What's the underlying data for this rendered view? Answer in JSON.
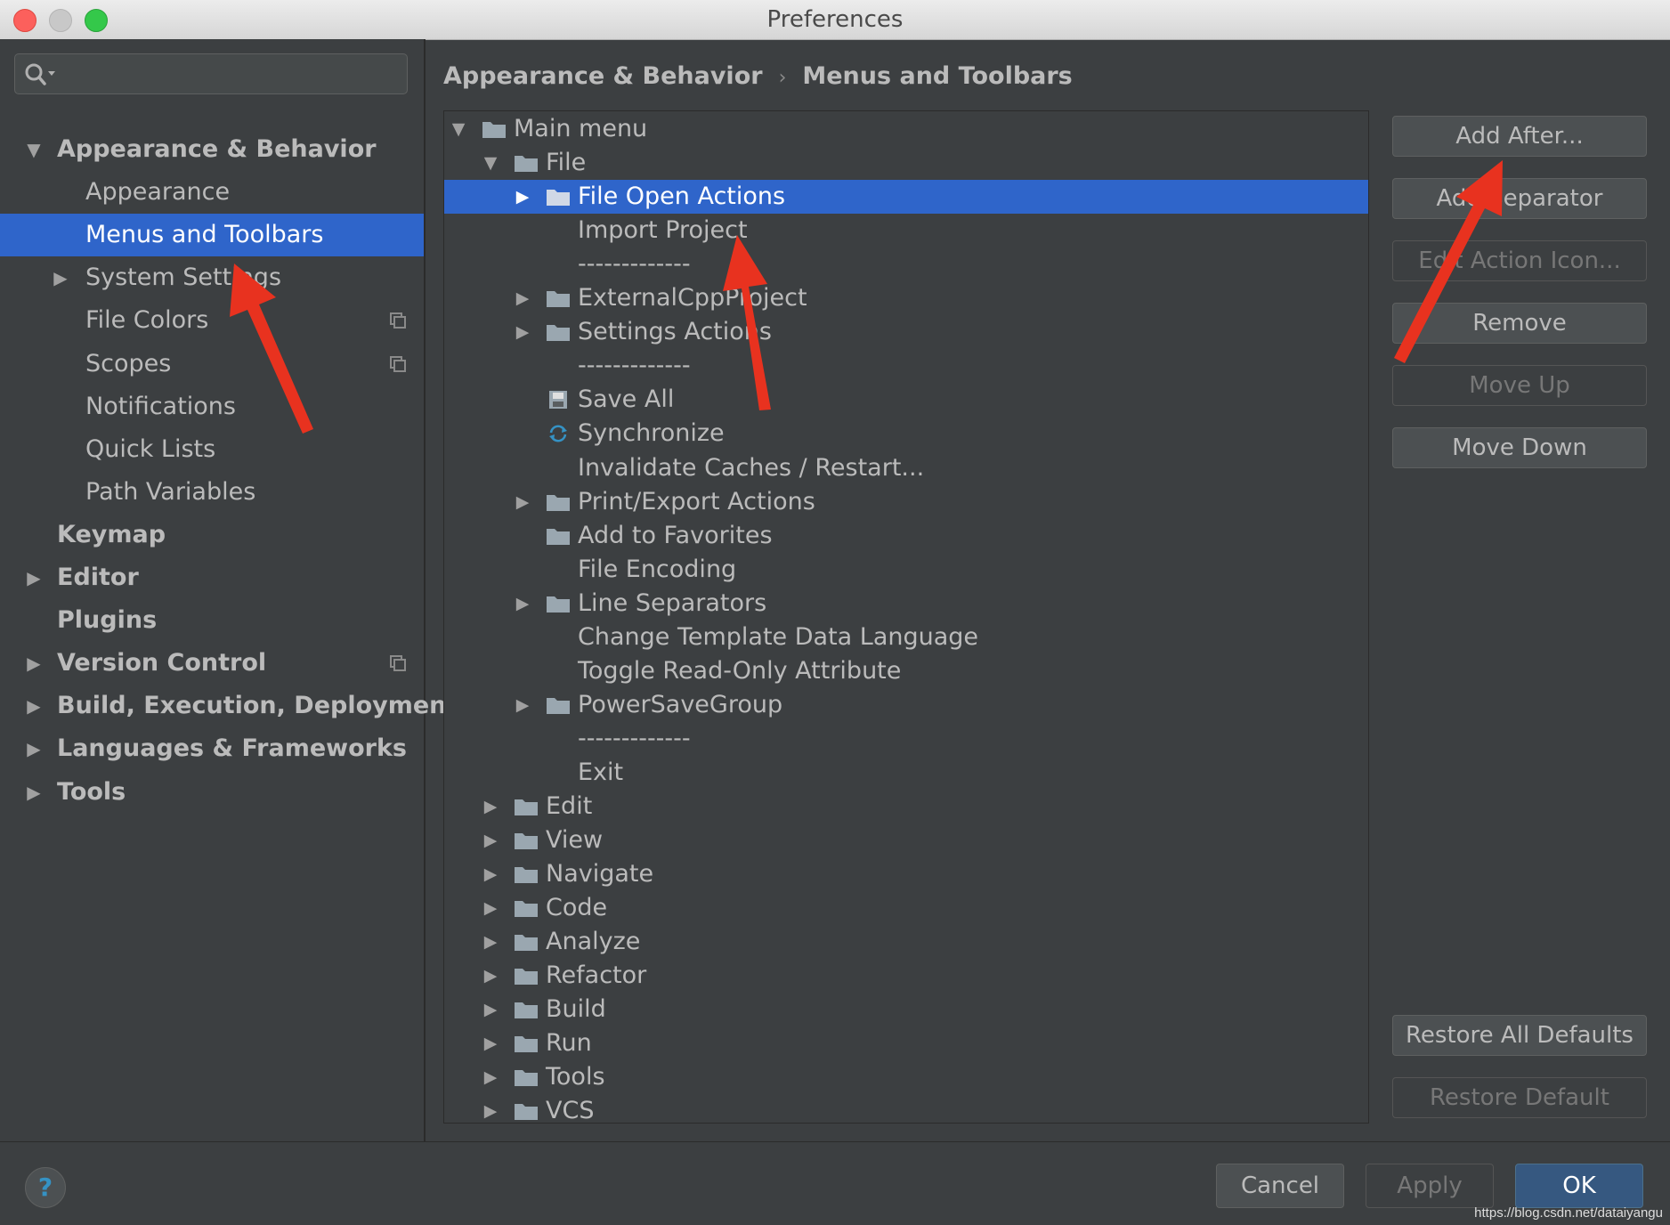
{
  "window": {
    "title": "Preferences"
  },
  "search": {
    "placeholder": ""
  },
  "sidebar": {
    "items": [
      {
        "label": "Appearance & Behavior",
        "bold": true,
        "arrow": "down",
        "indent": 0
      },
      {
        "label": "Appearance",
        "bold": false,
        "arrow": "",
        "indent": 1
      },
      {
        "label": "Menus and Toolbars",
        "bold": false,
        "arrow": "",
        "indent": 1,
        "selected": true
      },
      {
        "label": "System Settings",
        "bold": false,
        "arrow": "right",
        "indent": 1
      },
      {
        "label": "File Colors",
        "bold": false,
        "arrow": "",
        "indent": 1,
        "copy_icon": true
      },
      {
        "label": "Scopes",
        "bold": false,
        "arrow": "",
        "indent": 1,
        "copy_icon": true
      },
      {
        "label": "Notifications",
        "bold": false,
        "arrow": "",
        "indent": 1
      },
      {
        "label": "Quick Lists",
        "bold": false,
        "arrow": "",
        "indent": 1
      },
      {
        "label": "Path Variables",
        "bold": false,
        "arrow": "",
        "indent": 1
      },
      {
        "label": "Keymap",
        "bold": true,
        "arrow": "",
        "indent": 0
      },
      {
        "label": "Editor",
        "bold": true,
        "arrow": "right",
        "indent": 0
      },
      {
        "label": "Plugins",
        "bold": true,
        "arrow": "",
        "indent": 0
      },
      {
        "label": "Version Control",
        "bold": true,
        "arrow": "right",
        "indent": 0,
        "copy_icon": true
      },
      {
        "label": "Build, Execution, Deployment",
        "bold": true,
        "arrow": "right",
        "indent": 0
      },
      {
        "label": "Languages & Frameworks",
        "bold": true,
        "arrow": "right",
        "indent": 0
      },
      {
        "label": "Tools",
        "bold": true,
        "arrow": "right",
        "indent": 0
      }
    ]
  },
  "breadcrumb": {
    "parent": "Appearance & Behavior",
    "separator": "›",
    "current": "Menus and Toolbars"
  },
  "tree": {
    "rows": [
      {
        "label": "Main menu",
        "level": 0,
        "arrow": "down",
        "icon": "folder"
      },
      {
        "label": "File",
        "level": 1,
        "arrow": "down",
        "icon": "folder"
      },
      {
        "label": "File Open Actions",
        "level": 2,
        "arrow": "right",
        "icon": "folder",
        "selected": true
      },
      {
        "label": "Import Project",
        "level": 2,
        "arrow": "",
        "icon": ""
      },
      {
        "label": "-------------",
        "level": 2,
        "arrow": "",
        "icon": ""
      },
      {
        "label": "ExternalCppProject",
        "level": 2,
        "arrow": "right",
        "icon": "folder"
      },
      {
        "label": "Settings Actions",
        "level": 2,
        "arrow": "right",
        "icon": "folder"
      },
      {
        "label": "-------------",
        "level": 2,
        "arrow": "",
        "icon": ""
      },
      {
        "label": "Save All",
        "level": 2,
        "arrow": "",
        "icon": "save"
      },
      {
        "label": "Synchronize",
        "level": 2,
        "arrow": "",
        "icon": "sync"
      },
      {
        "label": "Invalidate Caches / Restart...",
        "level": 2,
        "arrow": "",
        "icon": ""
      },
      {
        "label": "Print/Export Actions",
        "level": 2,
        "arrow": "right",
        "icon": "folder"
      },
      {
        "label": "Add to Favorites",
        "level": 2,
        "arrow": "",
        "icon": "folder"
      },
      {
        "label": "File Encoding",
        "level": 2,
        "arrow": "",
        "icon": ""
      },
      {
        "label": "Line Separators",
        "level": 2,
        "arrow": "right",
        "icon": "folder"
      },
      {
        "label": "Change Template Data Language",
        "level": 2,
        "arrow": "",
        "icon": ""
      },
      {
        "label": "Toggle Read-Only Attribute",
        "level": 2,
        "arrow": "",
        "icon": ""
      },
      {
        "label": "PowerSaveGroup",
        "level": 2,
        "arrow": "right",
        "icon": "folder"
      },
      {
        "label": "-------------",
        "level": 2,
        "arrow": "",
        "icon": ""
      },
      {
        "label": "Exit",
        "level": 2,
        "arrow": "",
        "icon": ""
      },
      {
        "label": "Edit",
        "level": 1,
        "arrow": "right",
        "icon": "folder"
      },
      {
        "label": "View",
        "level": 1,
        "arrow": "right",
        "icon": "folder"
      },
      {
        "label": "Navigate",
        "level": 1,
        "arrow": "right",
        "icon": "folder"
      },
      {
        "label": "Code",
        "level": 1,
        "arrow": "right",
        "icon": "folder"
      },
      {
        "label": "Analyze",
        "level": 1,
        "arrow": "right",
        "icon": "folder"
      },
      {
        "label": "Refactor",
        "level": 1,
        "arrow": "right",
        "icon": "folder"
      },
      {
        "label": "Build",
        "level": 1,
        "arrow": "right",
        "icon": "folder"
      },
      {
        "label": "Run",
        "level": 1,
        "arrow": "right",
        "icon": "folder"
      },
      {
        "label": "Tools",
        "level": 1,
        "arrow": "right",
        "icon": "folder"
      },
      {
        "label": "VCS",
        "level": 1,
        "arrow": "right",
        "icon": "folder"
      }
    ]
  },
  "actions": {
    "add_after": "Add After...",
    "add_separator": "Add Separator",
    "edit_action_icon": "Edit Action Icon...",
    "remove": "Remove",
    "move_up": "Move Up",
    "move_down": "Move Down",
    "restore_all_defaults": "Restore All Defaults",
    "restore_default": "Restore Default"
  },
  "footer": {
    "help": "?",
    "cancel": "Cancel",
    "apply": "Apply",
    "ok": "OK",
    "watermark": "https://blog.csdn.net/dataiyangu"
  },
  "colors": {
    "selection": "#2f65ca",
    "annotation_arrow": "#e8321f",
    "primary_button": "#365880"
  }
}
